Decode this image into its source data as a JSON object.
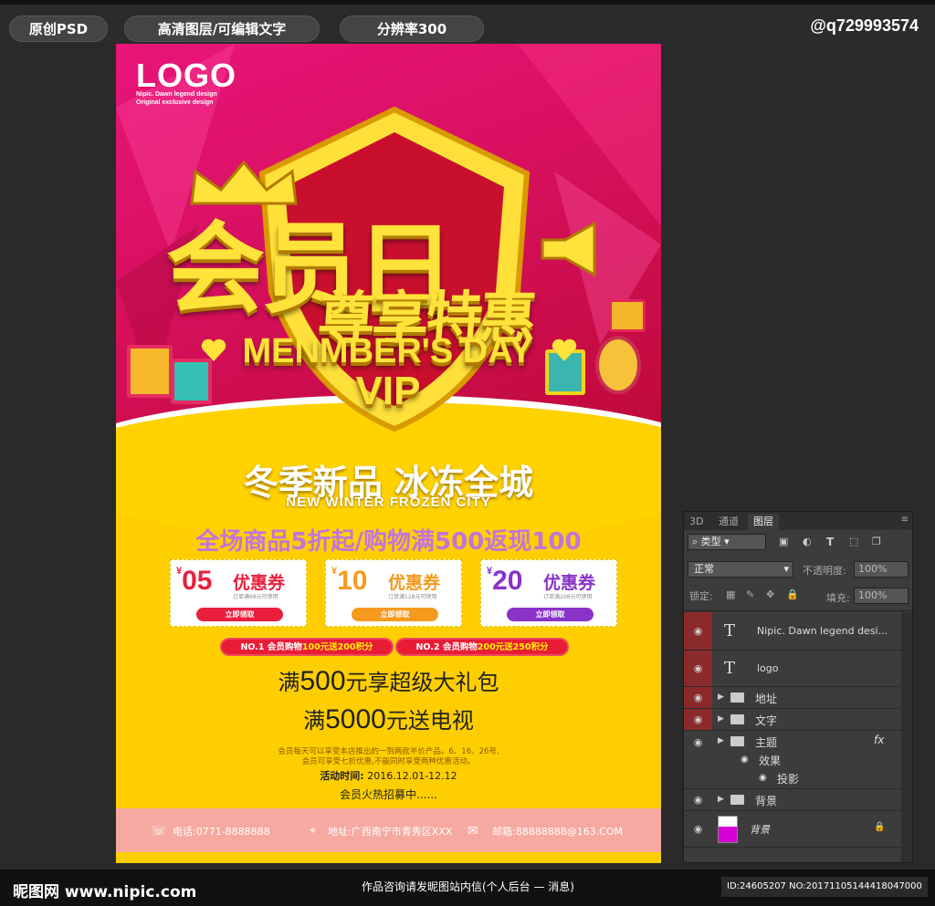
{
  "topbar": {
    "pills": [
      "原创PSD",
      "高清图层/可编辑文字",
      "分辨率300"
    ],
    "handle": "@q729993574"
  },
  "poster": {
    "logo": "LOGO",
    "logo_sub1": "Nipic. Dawn legend design",
    "logo_sub2": "Original exclusive design",
    "title_main": "会员日",
    "title_sub": "尊享特惠",
    "title_en": "MENMBER'S DAY",
    "title_vip": "VIP",
    "headline_cn": "冬季新品 冰冻全城",
    "headline_en": "NEW WINTER FROZEN CITY",
    "promo": "全场商品5折起/购物满500返现100",
    "coupons": [
      {
        "currency": "¥",
        "amount": "05",
        "label": "优惠券",
        "note": "订单满68元可使用",
        "button": "立即领取",
        "color": "#e8203e"
      },
      {
        "currency": "¥",
        "amount": "10",
        "label": "优惠券",
        "note": "订单满128元可使用",
        "button": "立即领取",
        "color": "#f59a1e"
      },
      {
        "currency": "¥",
        "amount": "20",
        "label": "优惠券",
        "note": "订单满208元可使用",
        "button": "立即领取",
        "color": "#8a33c9"
      }
    ],
    "tags": [
      {
        "prefix": "NO.1 会员购物",
        "highlight": "100元送200积分"
      },
      {
        "prefix": "NO.2 会员购物",
        "highlight": "200元送250积分"
      }
    ],
    "offer1_prefix": "满",
    "offer1_num": "500",
    "offer1_suffix": "元享超级大礼包",
    "offer2_prefix": "满",
    "offer2_num": "5000",
    "offer2_suffix": "元送电视",
    "small1": "会员每天可以享受本店推出的一到两款半价产品。6、16、26号,",
    "small2": "会员可享受七折优惠,不能同时享受两种优惠活动。",
    "event_label": "活动时间:",
    "event_date": "2016.12.01-12.12",
    "recruit": "会员火热招募中......",
    "phone": "电话:0771-8888888",
    "address": "地址:广西南宁市青秀区XXX",
    "email": "邮箱:88888888@163.COM"
  },
  "panel": {
    "tabs": [
      "3D",
      "通道",
      "图层"
    ],
    "filter": "类型",
    "blend": "正常",
    "opacity_label": "不透明度:",
    "opacity": "100%",
    "lock_label": "锁定:",
    "fill_label": "填充:",
    "fill": "100%",
    "layers": [
      {
        "kind": "text",
        "name": "Nipic. Dawn legend desi..."
      },
      {
        "kind": "text",
        "name": "logo"
      },
      {
        "kind": "folder",
        "name": "地址"
      },
      {
        "kind": "folder",
        "name": "文字"
      },
      {
        "kind": "folder",
        "name": "主题",
        "fx": "fx"
      },
      {
        "kind": "effect",
        "name": "效果"
      },
      {
        "kind": "effect2",
        "name": "投影"
      },
      {
        "kind": "folder",
        "name": "背景"
      },
      {
        "kind": "image",
        "name": "背景"
      }
    ]
  },
  "bottombar": {
    "site": "昵图网 www.nipic.com",
    "center": "作品咨询请发昵图站内信(个人后台 — 消息)",
    "id": "ID:24605207 NO:20171105144418047000"
  }
}
